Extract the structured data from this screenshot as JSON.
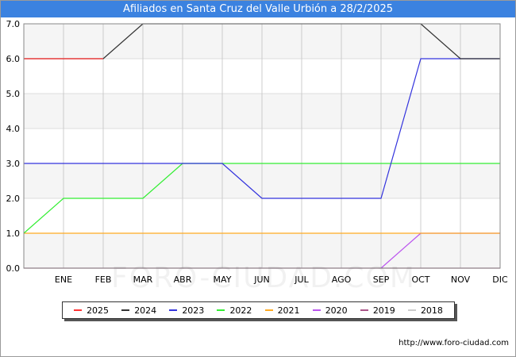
{
  "header": {
    "title": "Afiliados en Santa Cruz del Valle Urbión a 28/2/2025"
  },
  "footer": {
    "source": "http://www.foro-ciudad.com"
  },
  "watermark": "FORO-CIUDAD.COM",
  "chart_data": {
    "type": "line",
    "title": "Afiliados en Santa Cruz del Valle Urbión a 28/2/2025",
    "xlabel": "",
    "ylabel": "",
    "categories": [
      "ENE",
      "FEB",
      "MAR",
      "ABR",
      "MAY",
      "JUN",
      "JUL",
      "AGO",
      "SEP",
      "OCT",
      "NOV",
      "DIC"
    ],
    "yticks": [
      "0.0",
      "1.0",
      "2.0",
      "3.0",
      "4.0",
      "5.0",
      "6.0",
      "7.0"
    ],
    "ylim": [
      0,
      7
    ],
    "grid": true,
    "legend_position": "bottom",
    "series": [
      {
        "name": "2025",
        "color": "#ff3333",
        "start": [
          6
        ],
        "values": [
          6,
          6
        ]
      },
      {
        "name": "2024",
        "color": "#333333",
        "start": [
          6
        ],
        "values": [
          6,
          6,
          7,
          7,
          7,
          7,
          7,
          7,
          7,
          7,
          6,
          6
        ]
      },
      {
        "name": "2023",
        "color": "#3333dd",
        "start": [
          3
        ],
        "values": [
          3,
          3,
          3,
          3,
          3,
          2,
          2,
          2,
          2,
          6,
          6,
          6
        ]
      },
      {
        "name": "2022",
        "color": "#33ee33",
        "start": [
          1
        ],
        "values": [
          2,
          2,
          2,
          3,
          3,
          3,
          3,
          3,
          3,
          3,
          3,
          3
        ]
      },
      {
        "name": "2021",
        "color": "#ffaa22",
        "start": [
          1
        ],
        "values": [
          1,
          1,
          1,
          1,
          1,
          1,
          1,
          1,
          1,
          1,
          1,
          1
        ]
      },
      {
        "name": "2020",
        "color": "#bb55ee",
        "start": [],
        "values": [
          null,
          null,
          null,
          null,
          null,
          null,
          null,
          null,
          0,
          1,
          1,
          1
        ]
      },
      {
        "name": "2019",
        "color": "#aa5588",
        "start": [
          0
        ],
        "values": [
          0,
          0,
          0,
          0,
          0,
          0,
          0,
          0,
          0,
          0,
          0,
          0
        ]
      },
      {
        "name": "2018",
        "color": "#cccccc",
        "start": [],
        "values": []
      }
    ]
  }
}
